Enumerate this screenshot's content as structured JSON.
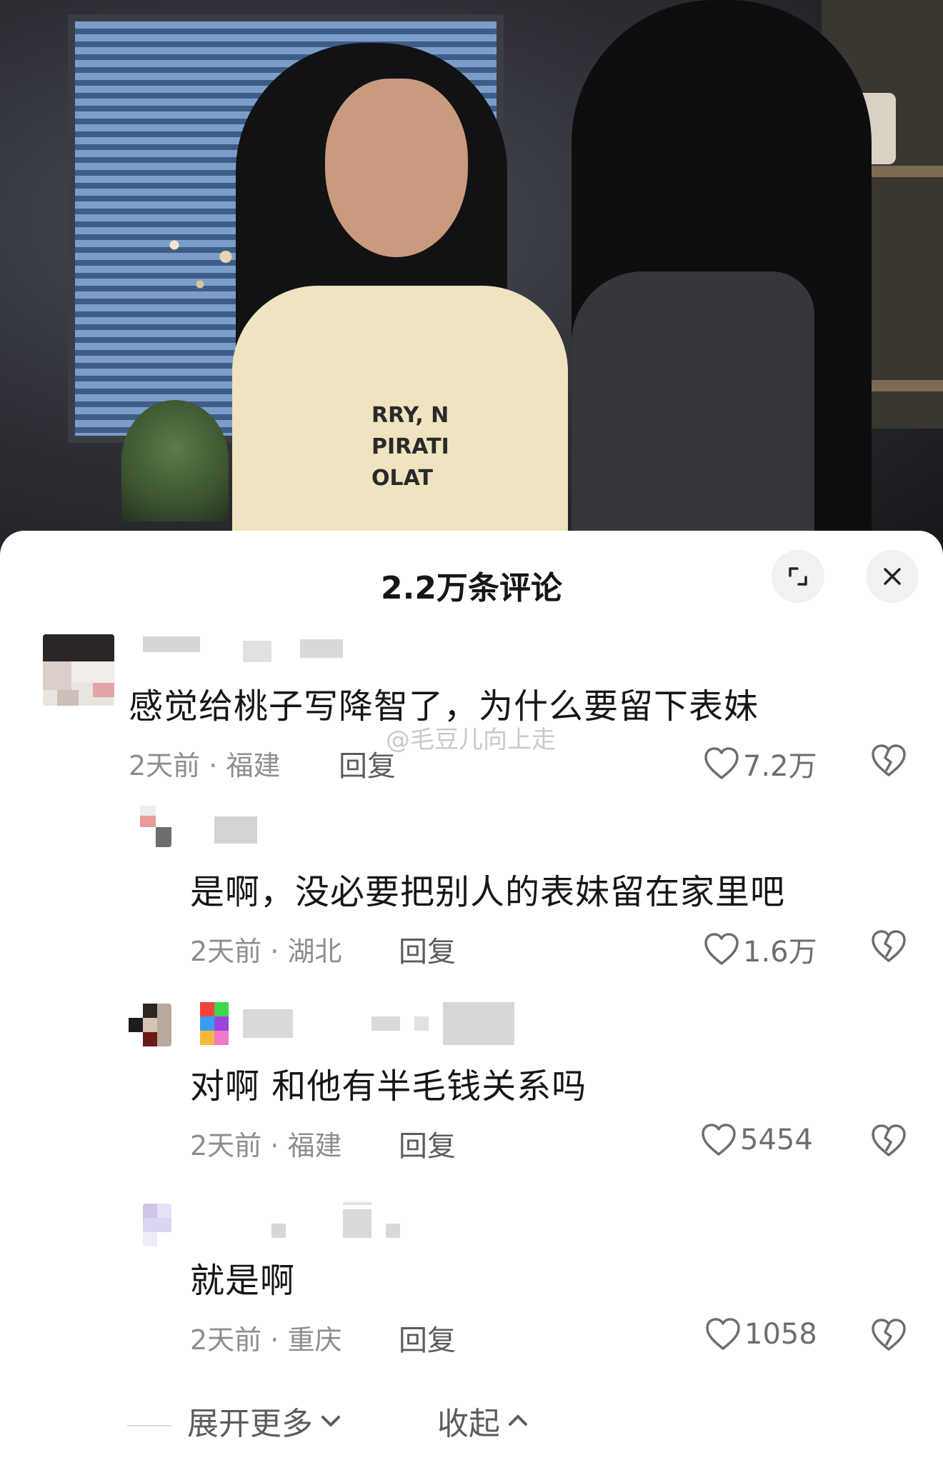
{
  "sheet": {
    "title": "2.2万条评论"
  },
  "watermark": "@毛豆儿向上走",
  "comments": [
    {
      "text": "感觉给桃子写降智了，为什么要留下表妹",
      "time": "2天前",
      "location": "福建",
      "reply_label": "回复",
      "likes": "7.2万"
    },
    {
      "text": "是啊，没必要把别人的表妹留在家里吧",
      "time": "2天前",
      "location": "湖北",
      "reply_label": "回复",
      "likes": "1.6万"
    },
    {
      "text": "对啊 和他有半毛钱关系吗",
      "time": "2天前",
      "location": "福建",
      "reply_label": "回复",
      "likes": "5454"
    },
    {
      "text": "就是啊",
      "time": "2天前",
      "location": "重庆",
      "reply_label": "回复",
      "likes": "1058"
    }
  ],
  "footer": {
    "expand_label": "展开更多",
    "collapse_label": "收起"
  },
  "video": {
    "shirt_text_lines": [
      "RRY, N",
      "PIRATI",
      "OLAT"
    ]
  },
  "colors": {
    "text_primary": "#161616",
    "text_secondary": "#8d8d91",
    "sheet_background": "#ffffff"
  }
}
